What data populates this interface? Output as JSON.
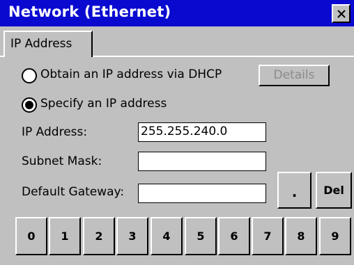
{
  "window": {
    "title": "Network (Ethernet)"
  },
  "icons": {
    "close": "close-icon"
  },
  "tabs": [
    {
      "label": "IP Address",
      "active": true
    }
  ],
  "ip_mode": {
    "dhcp_label": "Obtain an IP address via DHCP",
    "static_label": "Specify an IP address",
    "selected": "static",
    "details_label": "Details",
    "details_enabled": false
  },
  "fields": {
    "ip_address": {
      "label": "IP Address:",
      "value": "255.255.240.0"
    },
    "subnet_mask": {
      "label": "Subnet Mask:",
      "value": ""
    },
    "default_gateway": {
      "label": "Default Gateway:",
      "value": ""
    }
  },
  "keypad": {
    "dot_label": ".",
    "del_label": "Del",
    "digits": [
      "0",
      "1",
      "2",
      "3",
      "4",
      "5",
      "6",
      "7",
      "8",
      "9"
    ]
  }
}
